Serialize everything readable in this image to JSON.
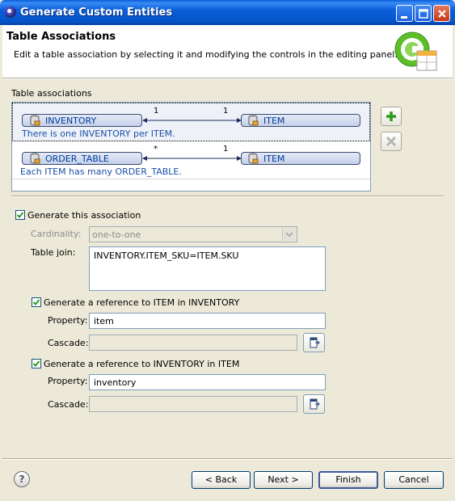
{
  "window": {
    "title": "Generate Custom Entities"
  },
  "banner": {
    "title": "Table Associations",
    "description": "Edit a table association by selecting it and modifying the controls in the editing panel."
  },
  "associations": {
    "label": "Table associations",
    "items": [
      {
        "left": "INVENTORY",
        "right": "ITEM",
        "left_card": "1",
        "right_card": "1",
        "description": "There is one INVENTORY per ITEM."
      },
      {
        "left": "ORDER_TABLE",
        "right": "ITEM",
        "left_card": "*",
        "right_card": "1",
        "description": "Each ITEM has many ORDER_TABLE."
      }
    ]
  },
  "editor": {
    "generate_label": "Generate this association",
    "cardinality_label": "Cardinality:",
    "cardinality_value": "one-to-one",
    "table_join_label": "Table join:",
    "table_join_value": "INVENTORY.ITEM_SKU=ITEM.SKU",
    "ref1": {
      "label": "Generate a reference to ITEM in INVENTORY",
      "property_label": "Property:",
      "property_value": "item",
      "cascade_label": "Cascade:",
      "cascade_value": ""
    },
    "ref2": {
      "label": "Generate a reference to INVENTORY in ITEM",
      "property_label": "Property:",
      "property_value": "inventory",
      "cascade_label": "Cascade:",
      "cascade_value": ""
    }
  },
  "buttons": {
    "back": "< Back",
    "next": "Next >",
    "finish": "Finish",
    "cancel": "Cancel",
    "help": "?"
  }
}
